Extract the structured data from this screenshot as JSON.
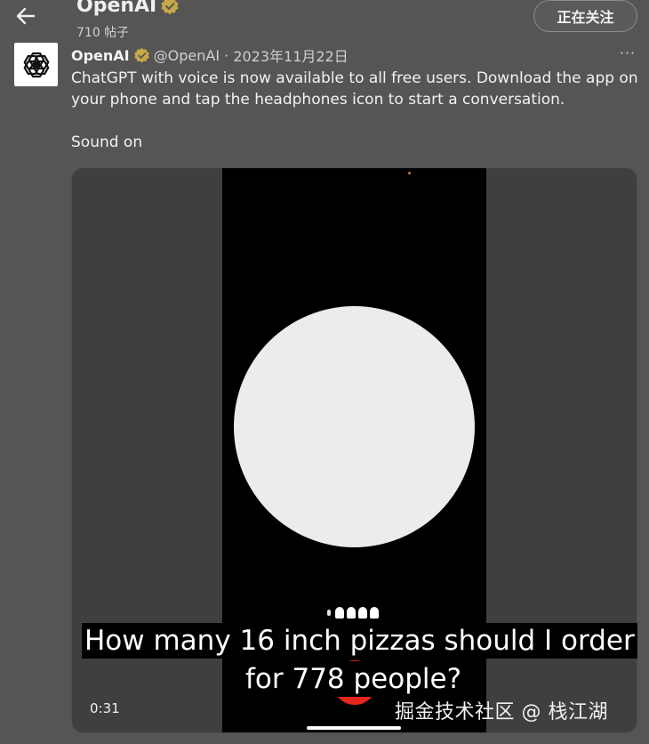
{
  "header": {
    "name": "OpenAI",
    "post_count": "710 帖子",
    "follow_label": "正在关注"
  },
  "tweet": {
    "author": "OpenAI",
    "handle": "@OpenAI",
    "separator": " · ",
    "date": "2023年11月22日",
    "more": "···",
    "text": "ChatGPT with voice is now available to all free users. Download the app on your phone and tap the headphones icon to start a conversation.",
    "sound_label": "Sound on"
  },
  "video": {
    "caption_line1": "How many 16 inch pizzas should I order",
    "caption_line2": "for 778 people?",
    "timestamp": "0:31"
  },
  "watermark": "掘金技术社区 @ 栈江湖",
  "colors": {
    "background": "#555555",
    "verified_badge": "#c7a94a",
    "record_button": "#e5251f"
  },
  "icons": {
    "back": "arrow-left-icon",
    "verified": "verified-badge-icon",
    "avatar": "openai-logo-icon",
    "more": "more-horizontal-icon"
  }
}
